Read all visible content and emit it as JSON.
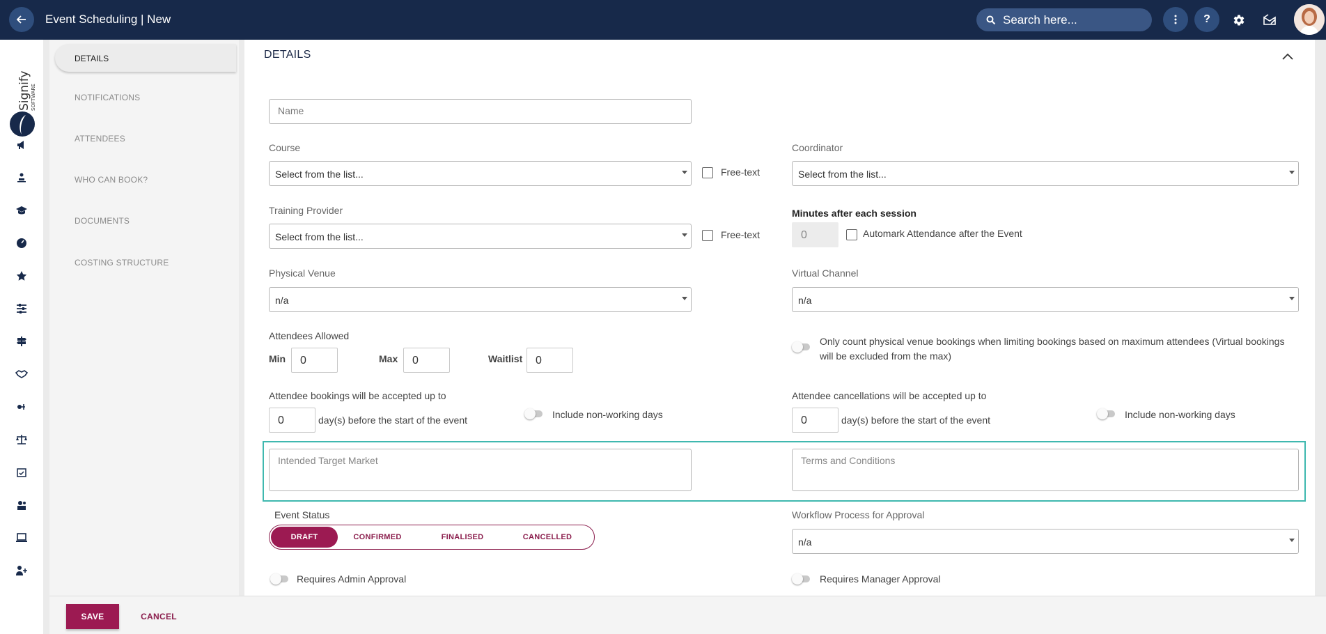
{
  "header": {
    "title": "Event Scheduling | New",
    "search_placeholder": "Search here..."
  },
  "nav": {
    "items": [
      {
        "label": "DETAILS",
        "active": true
      },
      {
        "label": "NOTIFICATIONS"
      },
      {
        "label": "ATTENDEES"
      },
      {
        "label": "WHO CAN BOOK?"
      },
      {
        "label": "DOCUMENTS"
      },
      {
        "label": "COSTING STRUCTURE"
      }
    ]
  },
  "logo": {
    "brand": "Signify",
    "sub": "SOFTWARE"
  },
  "section": {
    "title": "DETAILS"
  },
  "form": {
    "name_placeholder": "Name",
    "course_label": "Course",
    "course_value": "Select from the list...",
    "free_text_label": "Free-text",
    "coordinator_label": "Coordinator",
    "coordinator_value": "Select from the list...",
    "training_provider_label": "Training Provider",
    "training_provider_value": "Select from the list...",
    "minutes_label": "Minutes after each session",
    "minutes_value": "0",
    "automark_label": "Automark Attendance after the Event",
    "physical_venue_label": "Physical Venue",
    "physical_venue_value": "n/a",
    "virtual_channel_label": "Virtual Channel",
    "virtual_channel_value": "n/a",
    "attendees_allowed_label": "Attendees Allowed",
    "min_label": "Min",
    "min_value": "0",
    "max_label": "Max",
    "max_value": "0",
    "waitlist_label": "Waitlist",
    "waitlist_value": "0",
    "physical_only_label": "Only count physical venue bookings when limiting bookings based on maximum attendees (Virtual bookings",
    "physical_only_label_2": "will be excluded from the max)",
    "bookings_label": "Attendee bookings will be accepted up to",
    "bookings_value": "0",
    "days_before_label": "day(s) before the start of the event",
    "include_nonworking_label": "Include non-working days",
    "cancellations_label": "Attendee cancellations will be accepted up to",
    "cancellations_value": "0",
    "target_market_placeholder": "Intended Target Market",
    "terms_placeholder": "Terms and Conditions",
    "event_status_label": "Event Status",
    "status_options": [
      "DRAFT",
      "CONFIRMED",
      "FINALISED",
      "CANCELLED"
    ],
    "workflow_label": "Workflow Process for Approval",
    "workflow_value": "n/a",
    "admin_approval_label": "Requires Admin Approval",
    "manager_approval_label": "Requires Manager Approval"
  },
  "footer": {
    "save_label": "SAVE",
    "cancel_label": "CANCEL"
  },
  "colors": {
    "topbar": "#17294a",
    "accent": "#9c1a52",
    "highlight": "#3fb8af"
  }
}
